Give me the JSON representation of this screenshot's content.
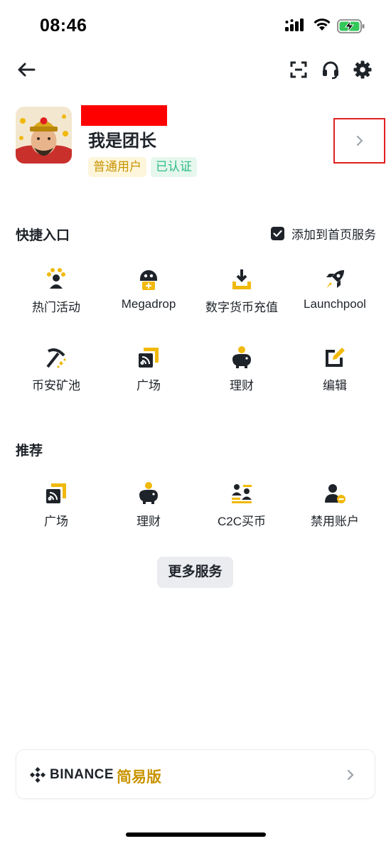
{
  "status_bar": {
    "time": "08:46"
  },
  "profile": {
    "username": "我是团长",
    "badge_user": "普通用户",
    "badge_verified": "已认证"
  },
  "shortcuts": {
    "title": "快捷入口",
    "add_to_home": "添加到首页服务",
    "items": [
      {
        "label": "热门活动",
        "icon": "hot-events-icon"
      },
      {
        "label": "Megadrop",
        "icon": "megadrop-icon"
      },
      {
        "label": "数字货币充值",
        "icon": "deposit-icon"
      },
      {
        "label": "Launchpool",
        "icon": "rocket-icon"
      },
      {
        "label": "币安矿池",
        "icon": "pickaxe-icon"
      },
      {
        "label": "广场",
        "icon": "square-feed-icon"
      },
      {
        "label": "理财",
        "icon": "piggy-bank-icon"
      },
      {
        "label": "编辑",
        "icon": "edit-icon"
      }
    ]
  },
  "recommended": {
    "title": "推荐",
    "items": [
      {
        "label": "广场",
        "icon": "square-feed-icon"
      },
      {
        "label": "理财",
        "icon": "piggy-bank-icon"
      },
      {
        "label": "C2C买币",
        "icon": "c2c-icon"
      },
      {
        "label": "禁用账户",
        "icon": "disable-account-icon"
      }
    ]
  },
  "more_services": "更多服务",
  "lite_banner": {
    "brand": "BINANCE",
    "label": "简易版"
  },
  "colors": {
    "accent": "#f0b90b",
    "text": "#1e2329",
    "badge_user_text": "#c99400",
    "badge_verified_text": "#2ebd85"
  }
}
